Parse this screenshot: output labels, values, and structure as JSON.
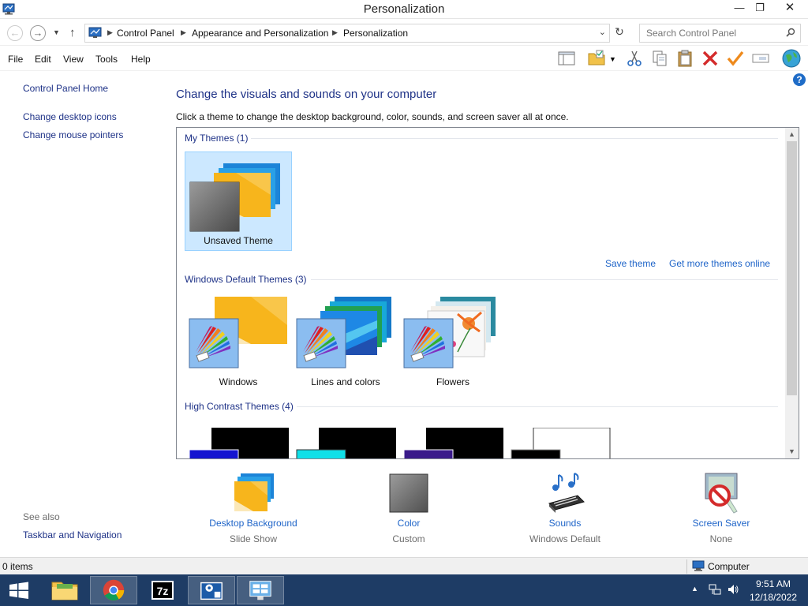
{
  "window": {
    "title": "Personalization"
  },
  "window_controls": {
    "minimize": "—",
    "restore": "❐",
    "close": "✕"
  },
  "address": {
    "crumbs": [
      "Control Panel",
      "Appearance and Personalization",
      "Personalization"
    ],
    "search_placeholder": "Search Control Panel"
  },
  "menu": [
    "File",
    "Edit",
    "View",
    "Tools",
    "Help"
  ],
  "sidebar": {
    "links": [
      "Control Panel Home",
      "Change desktop icons",
      "Change mouse pointers"
    ],
    "see_also_label": "See also",
    "see_also_links": [
      "Taskbar and Navigation"
    ]
  },
  "main": {
    "title": "Change the visuals and sounds on your computer",
    "subtitle": "Click a theme to change the desktop background, color, sounds, and screen saver all at once."
  },
  "themes": {
    "my_themes": {
      "header": "My Themes (1)",
      "items": [
        "Unsaved Theme"
      ]
    },
    "links": {
      "save": "Save theme",
      "more": "Get more themes online"
    },
    "default_themes": {
      "header": "Windows Default Themes (3)",
      "items": [
        "Windows",
        "Lines and colors",
        "Flowers"
      ]
    },
    "high_contrast": {
      "header": "High Contrast Themes (4)"
    }
  },
  "settings": [
    {
      "name": "Desktop Background",
      "value": "Slide Show"
    },
    {
      "name": "Color",
      "value": "Custom"
    },
    {
      "name": "Sounds",
      "value": "Windows Default"
    },
    {
      "name": "Screen Saver",
      "value": "None"
    }
  ],
  "statusbar": {
    "items": "0 items",
    "location": "Computer"
  },
  "taskbar": {
    "time": "9:51 AM",
    "date": "12/18/2022"
  },
  "colors": {
    "link": "#1e3287",
    "accent": "#1e64c8",
    "taskbar": "#1e3c65",
    "selection": "#cce8ff"
  }
}
